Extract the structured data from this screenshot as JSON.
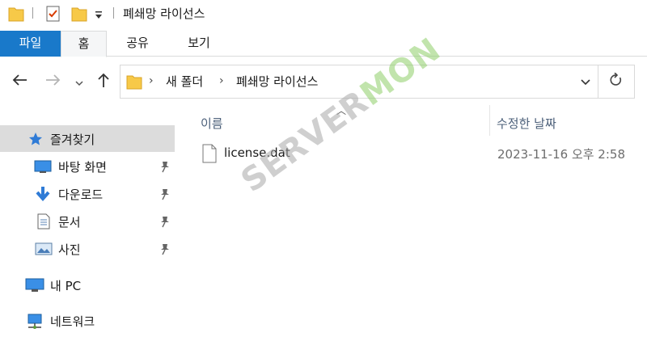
{
  "window": {
    "title": "폐쇄망 라이선스"
  },
  "ribbon": {
    "tabs": [
      "파일",
      "홈",
      "공유",
      "보기"
    ]
  },
  "address": {
    "crumbs": [
      "새 폴더",
      "폐쇄망 라이선스"
    ]
  },
  "sidebar": {
    "quick_access": "즐겨찾기",
    "items": [
      "바탕 화면",
      "다운로드",
      "문서",
      "사진"
    ],
    "this_pc": "내 PC",
    "network": "네트워크"
  },
  "columns": {
    "name": "이름",
    "date": "수정한 날짜"
  },
  "files": [
    {
      "name": "license.dat",
      "date": "2023-11-16 오후 2:58"
    }
  ],
  "watermark": {
    "part1": "SERVER",
    "part2": "MON"
  },
  "colors": {
    "accent": "#1979ca",
    "selected": "#dcdcdc",
    "folder": "#f7c948"
  },
  "icons": [
    "folder-icon",
    "properties-icon",
    "chevron-down-icon",
    "back-arrow-icon",
    "forward-arrow-icon",
    "up-arrow-icon",
    "refresh-icon",
    "star-icon",
    "desktop-icon",
    "download-icon",
    "document-icon",
    "picture-icon",
    "pc-icon",
    "network-icon",
    "pin-icon",
    "file-icon"
  ]
}
